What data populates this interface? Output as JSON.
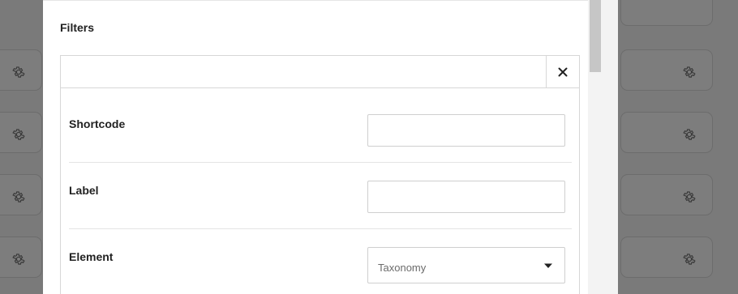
{
  "modal": {
    "section_title": "Filters",
    "header_input": {
      "value": "",
      "placeholder": ""
    },
    "close_icon": "close-icon",
    "fields": {
      "shortcode": {
        "label": "Shortcode",
        "value": ""
      },
      "label": {
        "label": "Label",
        "value": ""
      },
      "element": {
        "label": "Element",
        "selected": "Taxonomy"
      }
    }
  },
  "background": {
    "row_icon": "gear-icon"
  },
  "colors": {
    "overlay": "#7a7a7a",
    "modal_bg": "#ffffff",
    "border": "#d7d7d7",
    "text": "#222222",
    "muted_text": "#6b6b6b"
  }
}
